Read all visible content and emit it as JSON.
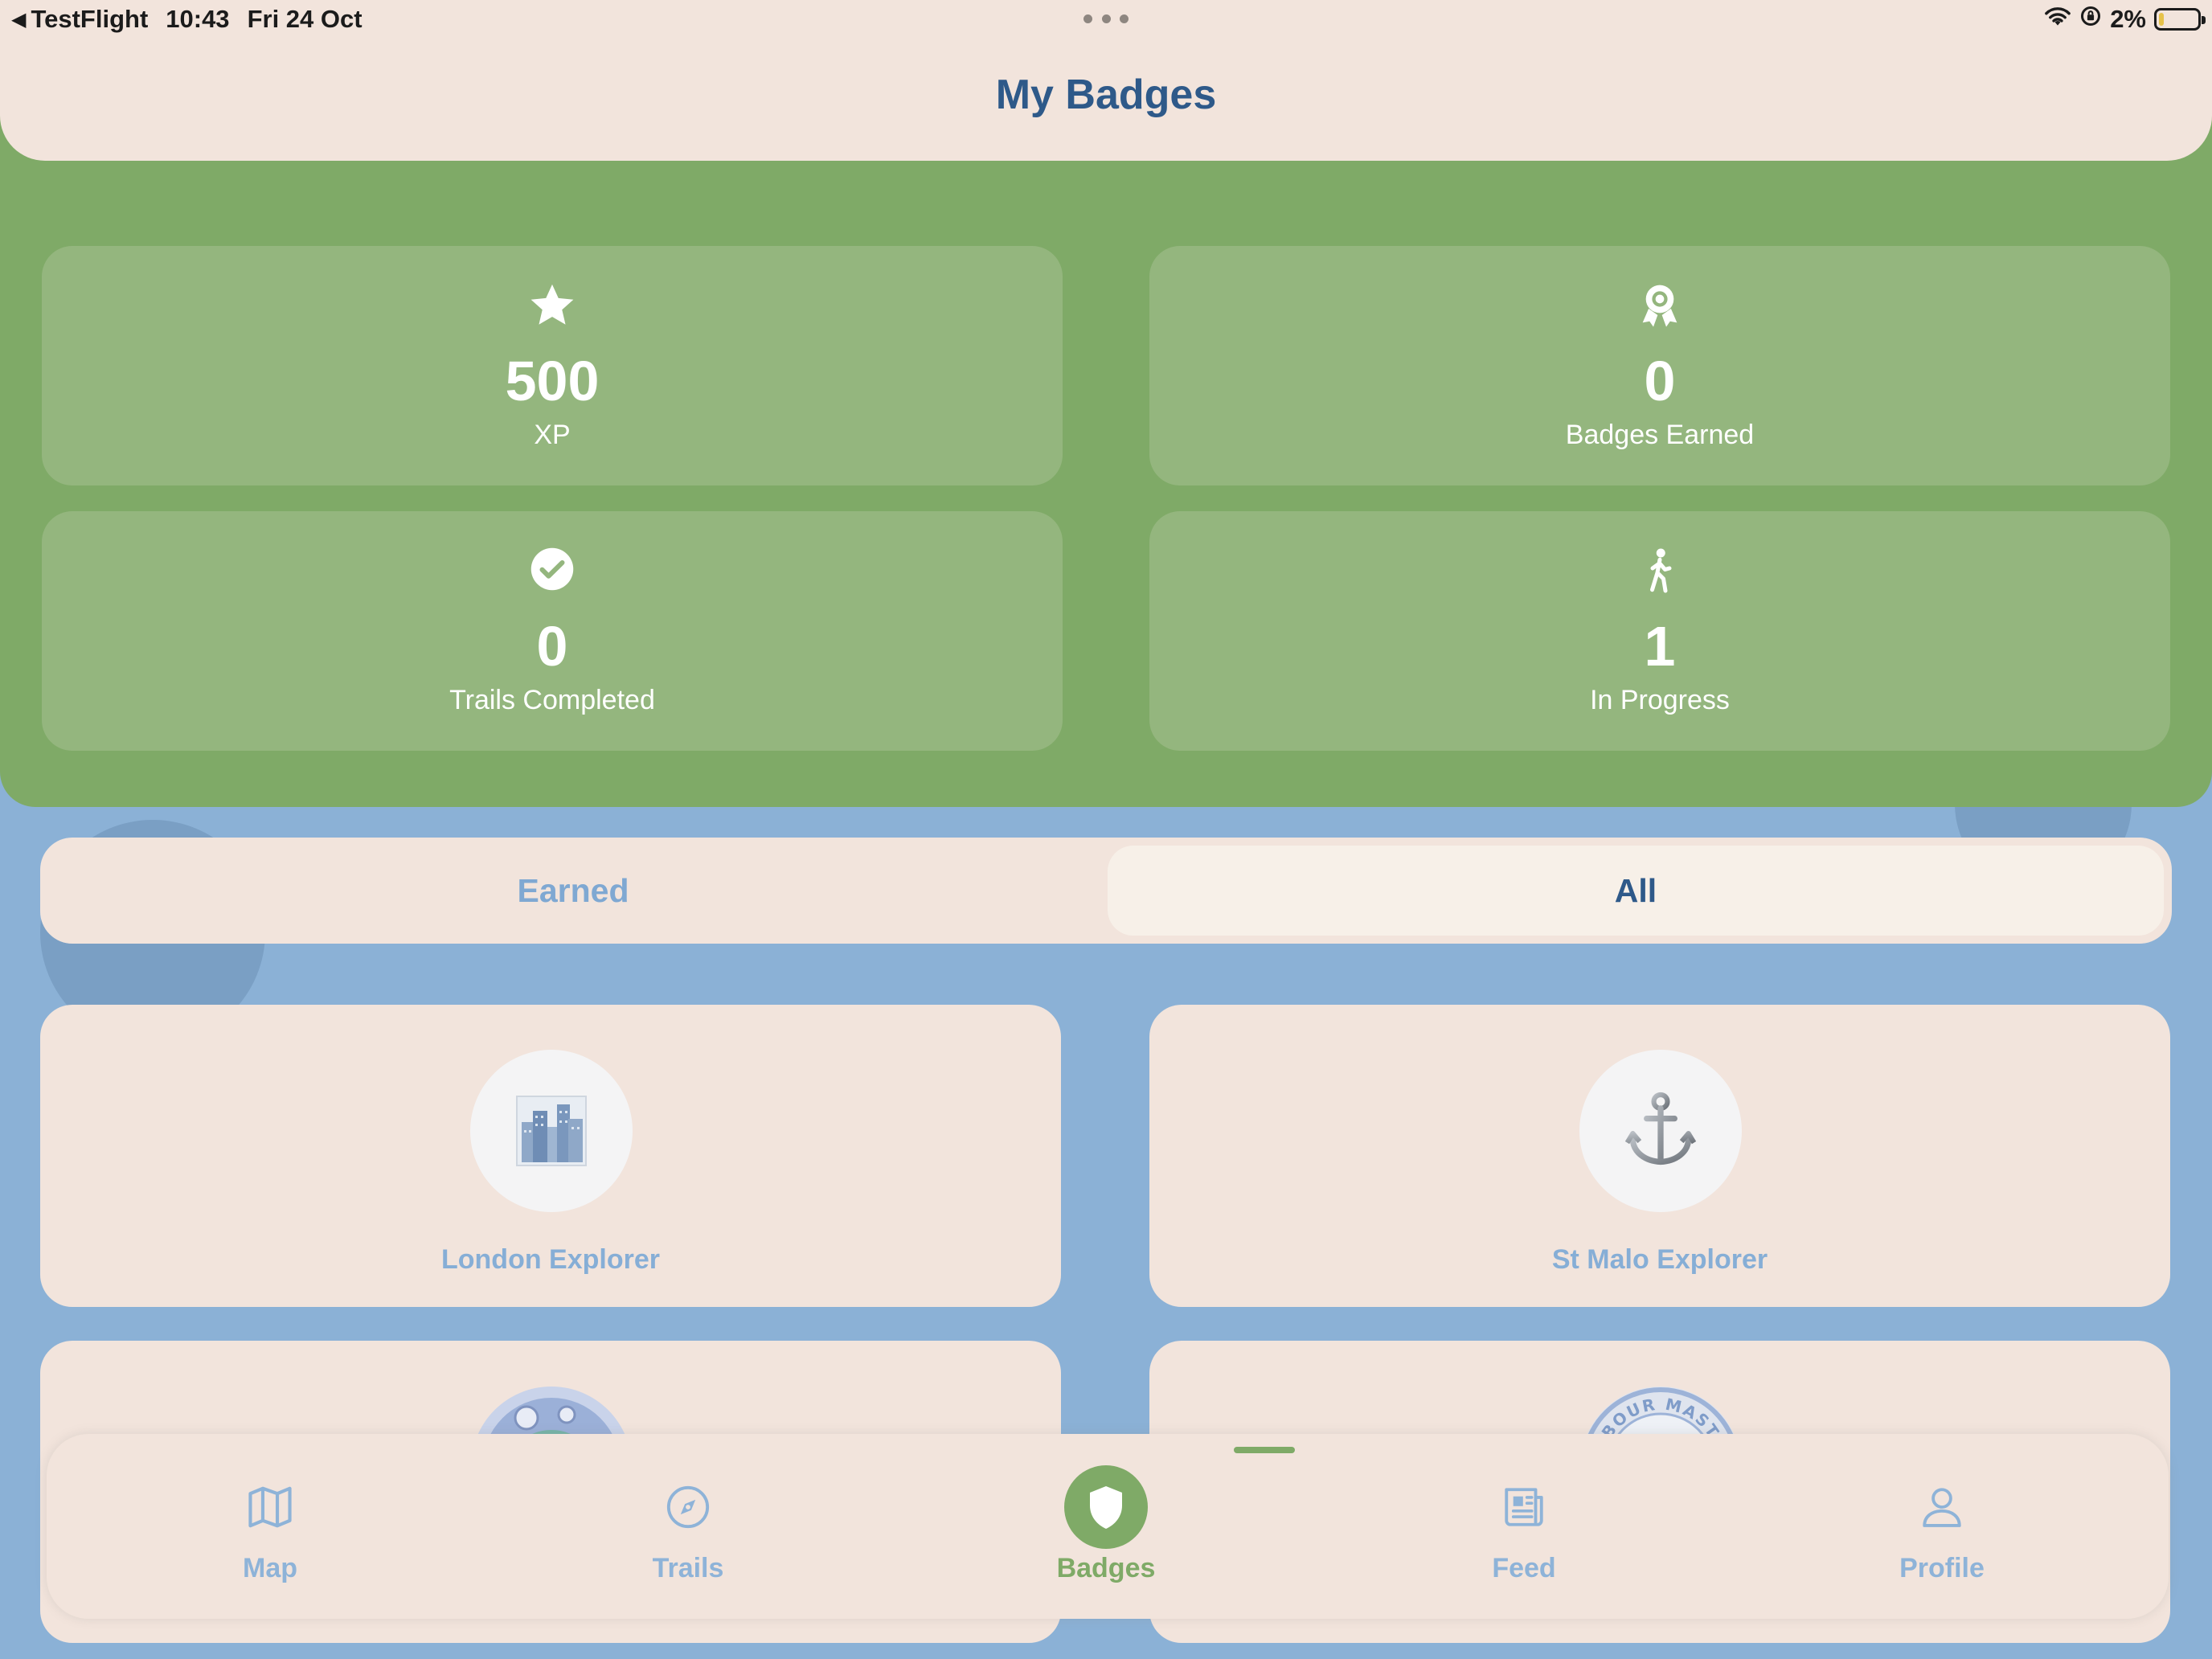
{
  "status_bar": {
    "app": "TestFlight",
    "time": "10:43",
    "date": "Fri 24 Oct",
    "battery": "2%"
  },
  "header": {
    "title": "My Badges"
  },
  "stats": [
    {
      "icon": "star-icon",
      "value": "500",
      "label": "XP"
    },
    {
      "icon": "award-icon",
      "value": "0",
      "label": "Badges Earned"
    },
    {
      "icon": "checkmark-circle-icon",
      "value": "0",
      "label": "Trails Completed"
    },
    {
      "icon": "walking-figure-icon",
      "value": "1",
      "label": "In Progress"
    }
  ],
  "segment": {
    "options": [
      "Earned",
      "All"
    ],
    "selected": "All"
  },
  "badges": [
    {
      "name": "London Explorer",
      "icon": "cityscape-icon"
    },
    {
      "name": "St Malo Explorer",
      "icon": "anchor-icon"
    },
    {
      "name": "",
      "icon": "globe-badge-icon"
    },
    {
      "name": "",
      "icon": "harbour-master-badge-icon",
      "partial_text": "BOUR MAST"
    }
  ],
  "tabs": [
    {
      "label": "Map",
      "icon": "map-icon"
    },
    {
      "label": "Trails",
      "icon": "compass-icon"
    },
    {
      "label": "Badges",
      "icon": "shield-icon",
      "active": true
    },
    {
      "label": "Feed",
      "icon": "newspaper-icon"
    },
    {
      "label": "Profile",
      "icon": "person-icon"
    }
  ],
  "colors": {
    "background": "#8bb1d6",
    "panel_green": "#7faa67",
    "card_green": "#94b67e",
    "cream": "#f2e4dc",
    "title_blue": "#2e5989",
    "muted_blue": "#86aed6"
  }
}
